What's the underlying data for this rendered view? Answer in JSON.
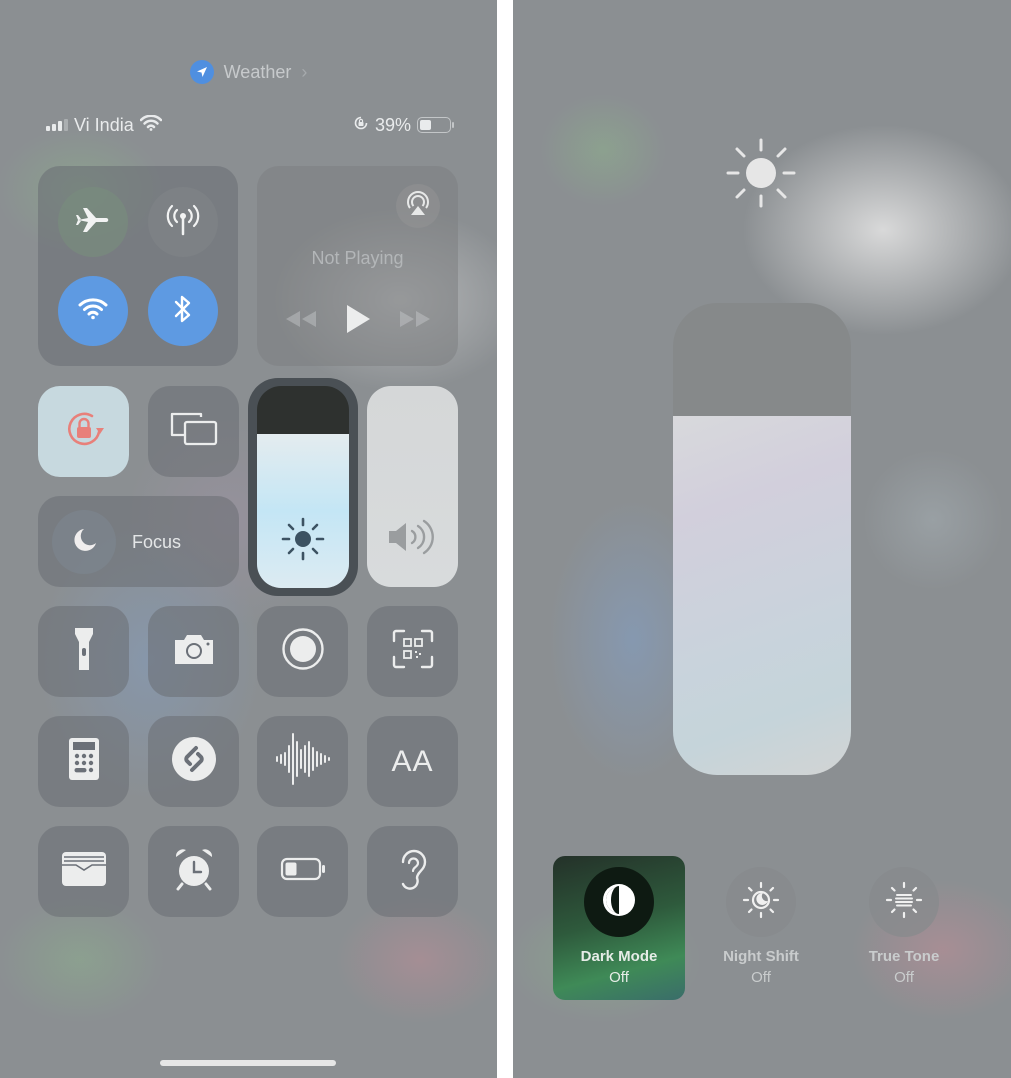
{
  "left": {
    "now_playing_app": {
      "label": "Weather",
      "icon": "location-arrow-icon",
      "accent": "#4f8fe0"
    },
    "status_bar": {
      "carrier": "Vi India",
      "signal_bars_active": 3,
      "signal_bars_total": 4,
      "wifi_icon": "wifi-icon",
      "orientation_lock_icon": "orientation-lock-icon",
      "battery_percent_label": "39%",
      "battery_level": 0.39
    },
    "connectivity": {
      "airplane_mode": {
        "icon": "airplane-icon",
        "on": false
      },
      "cellular_data": {
        "icon": "antenna-icon",
        "on": false
      },
      "wifi": {
        "icon": "wifi-icon",
        "on": true
      },
      "bluetooth": {
        "icon": "bluetooth-icon",
        "on": true
      },
      "active_color": "#5e9ae2"
    },
    "media": {
      "status": "Not Playing",
      "airplay_icon": "airplay-audio-icon",
      "controls": [
        "rewind-icon",
        "play-icon",
        "fast-forward-icon"
      ]
    },
    "orientation_lock": {
      "icon": "rotation-lock-icon",
      "on": true,
      "icon_color": "#e8807a"
    },
    "screen_mirroring": {
      "icon": "screen-mirroring-icon"
    },
    "focus": {
      "label": "Focus",
      "icon": "moon-icon"
    },
    "brightness": {
      "icon": "sun-icon",
      "level": 0.76
    },
    "volume": {
      "icon": "speaker-wave-icon",
      "level": 1.0
    },
    "shortcuts": [
      {
        "name": "flashlight",
        "icon": "flashlight-icon"
      },
      {
        "name": "camera",
        "icon": "camera-icon"
      },
      {
        "name": "screen-recording",
        "icon": "record-icon"
      },
      {
        "name": "code-scanner",
        "icon": "qr-code-icon"
      },
      {
        "name": "calculator",
        "icon": "calculator-icon"
      },
      {
        "name": "shazam",
        "icon": "shazam-icon"
      },
      {
        "name": "voice-memos",
        "icon": "waveform-icon"
      },
      {
        "name": "text-size",
        "icon": "text-size-icon",
        "label": "AA"
      },
      {
        "name": "wallet",
        "icon": "wallet-icon"
      },
      {
        "name": "alarm",
        "icon": "alarm-clock-icon"
      },
      {
        "name": "low-power-mode",
        "icon": "battery-icon"
      },
      {
        "name": "hearing",
        "icon": "ear-icon"
      }
    ]
  },
  "right": {
    "brightness_icon": "sun-icon",
    "brightness": {
      "level": 0.76
    },
    "toggles": [
      {
        "label": "Dark Mode",
        "state": "Off",
        "icon": "dark-mode-icon",
        "highlighted": true
      },
      {
        "label": "Night Shift",
        "state": "Off",
        "icon": "night-shift-icon",
        "highlighted": false
      },
      {
        "label": "True Tone",
        "state": "Off",
        "icon": "true-tone-icon",
        "highlighted": false
      }
    ]
  }
}
